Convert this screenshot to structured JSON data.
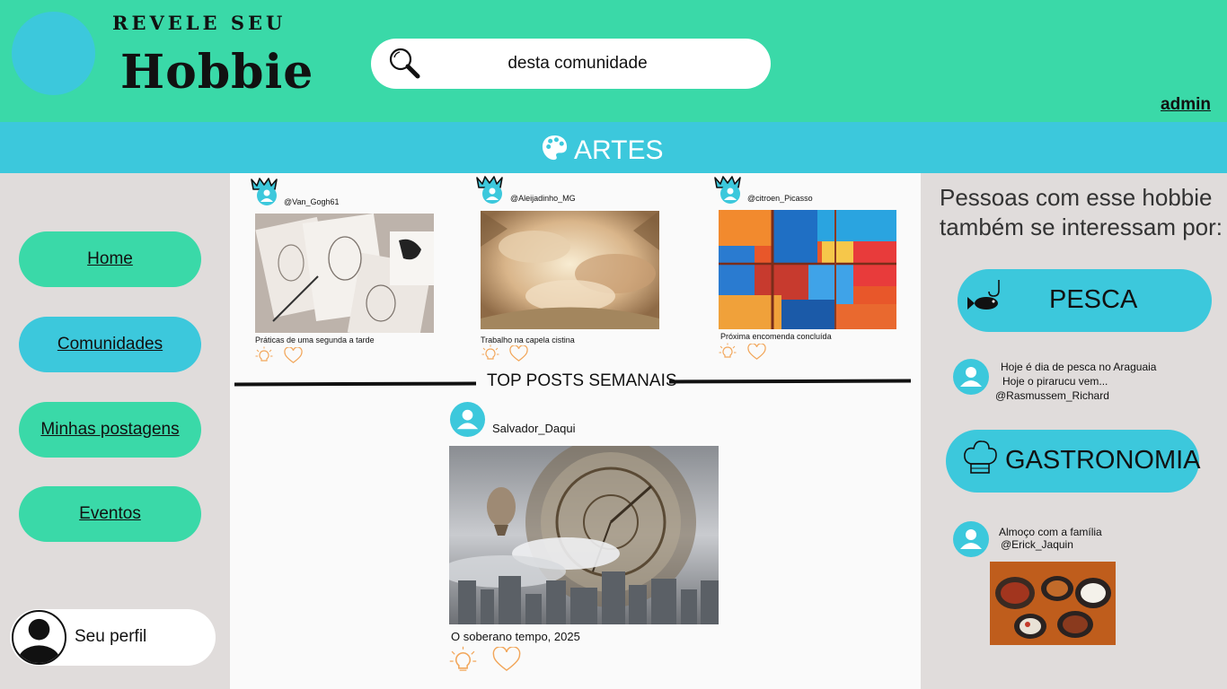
{
  "header": {
    "brand_top": "REVELE SEU",
    "brand_main": "Hobbie",
    "search_value": "desta comunidade",
    "admin_label": "admin"
  },
  "category": {
    "icon": "palette-icon",
    "title": "ARTES"
  },
  "sidebar": {
    "items": [
      {
        "label": "Home"
      },
      {
        "label": "Comunidades"
      },
      {
        "label": "Minhas postagens"
      },
      {
        "label": "Eventos"
      }
    ],
    "profile_label": "Seu perfil"
  },
  "feed": {
    "posts": [
      {
        "user": "@Van_Gogh61",
        "caption": "Práticas de uma segunda a tarde"
      },
      {
        "user": "@Aleijadinho_MG",
        "caption": "Trabalho na capela cistina"
      },
      {
        "user": "@citroen_Picasso",
        "caption": "Próxima encomenda concluída"
      }
    ],
    "top_title": "TOP POSTS SEMANAIS",
    "top_post": {
      "user": "Salvador_Daqui",
      "caption": "O soberano tempo, 2025"
    }
  },
  "right": {
    "heading": "Pessoas com esse hobbie também se interessam por:",
    "interests": [
      {
        "label": "PESCA",
        "icon": "fish-hook-icon",
        "post_lines": [
          "Hoje é dia de pesca no Araguaia",
          "Hoje o pirarucu vem..."
        ],
        "post_user": "@Rasmussem_Richard"
      },
      {
        "label": "GASTRONOMIA",
        "icon": "chef-hat-icon",
        "post_lines": [
          "Almoço com a família"
        ],
        "post_user": "@Erick_Jaquin"
      }
    ]
  },
  "colors": {
    "header_green": "#3ad9a8",
    "accent_blue": "#3cc8dc",
    "sidebar_bg": "#e0dcdb",
    "feed_bg": "#fafafa",
    "icon_orange": "#f2a65a"
  }
}
